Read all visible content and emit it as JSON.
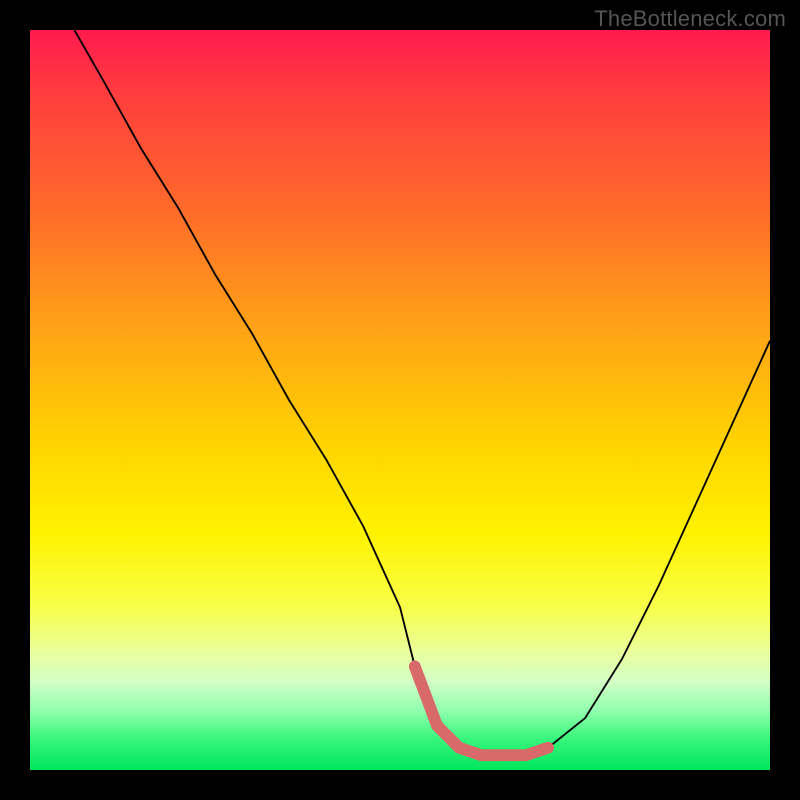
{
  "watermark": "TheBottleneck.com",
  "chart_data": {
    "type": "line",
    "title": "",
    "xlabel": "",
    "ylabel": "",
    "xlim": [
      0,
      100
    ],
    "ylim": [
      0,
      100
    ],
    "annotations": [],
    "series": [
      {
        "name": "curve",
        "color": "#000000",
        "x": [
          6,
          10,
          15,
          20,
          25,
          30,
          35,
          40,
          45,
          50,
          52,
          55,
          58,
          61,
          64,
          67,
          70,
          75,
          80,
          85,
          90,
          95,
          100
        ],
        "y": [
          100,
          93,
          84,
          76,
          67,
          59,
          50,
          42,
          33,
          22,
          14,
          6,
          3,
          2,
          2,
          2,
          3,
          7,
          15,
          25,
          36,
          47,
          58
        ]
      },
      {
        "name": "highlight",
        "color": "#d86a6a",
        "x": [
          52,
          55,
          58,
          61,
          64,
          67,
          70
        ],
        "y": [
          14,
          6,
          3,
          2,
          2,
          2,
          3
        ]
      }
    ],
    "gradient_stops": [
      {
        "pos": 0,
        "color": "#ff1a4e"
      },
      {
        "pos": 8,
        "color": "#ff3b3f"
      },
      {
        "pos": 24,
        "color": "#ff6a2a"
      },
      {
        "pos": 42,
        "color": "#ffa814"
      },
      {
        "pos": 56,
        "color": "#ffd400"
      },
      {
        "pos": 68,
        "color": "#fff200"
      },
      {
        "pos": 78,
        "color": "#f8ff4a"
      },
      {
        "pos": 84,
        "color": "#eaff9c"
      },
      {
        "pos": 88,
        "color": "#d4ffc6"
      },
      {
        "pos": 92,
        "color": "#90ffad"
      },
      {
        "pos": 96,
        "color": "#34f57a"
      },
      {
        "pos": 100,
        "color": "#00e65c"
      }
    ]
  }
}
